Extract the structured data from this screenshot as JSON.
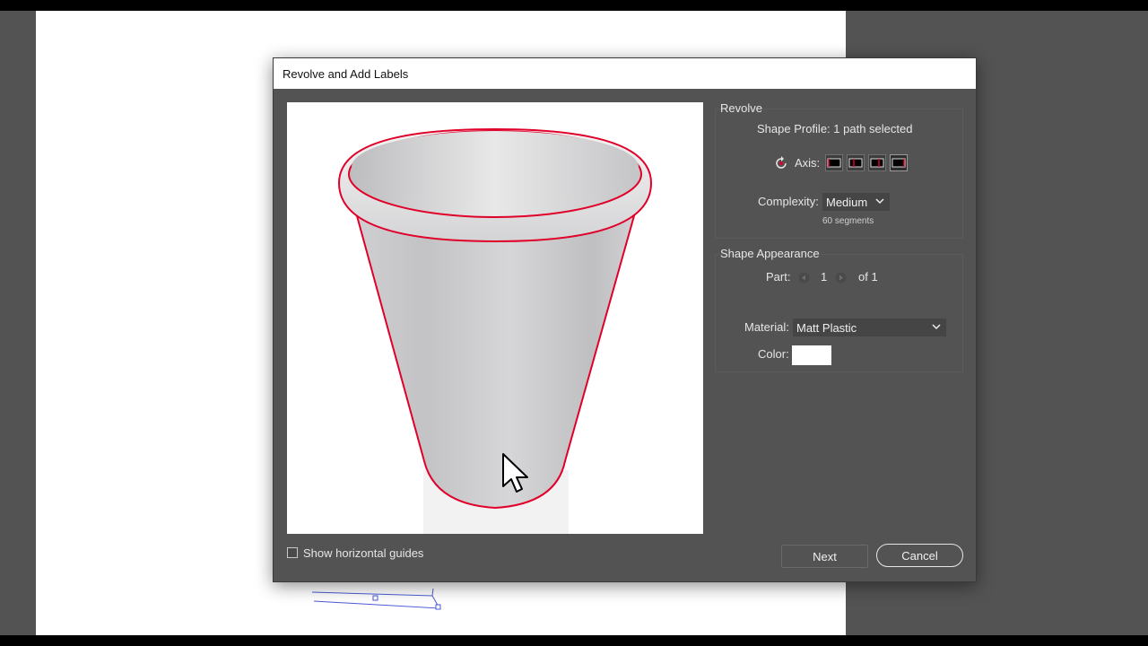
{
  "dialog": {
    "title": "Revolve and Add Labels",
    "revolve": {
      "header": "Revolve",
      "shape_profile": "Shape Profile: 1 path selected",
      "axis_label": "Axis:",
      "complexity_label": "Complexity:",
      "complexity_value": "Medium",
      "segments": "60 segments"
    },
    "appearance": {
      "header": "Shape Appearance",
      "part_label": "Part:",
      "part_value": "1",
      "part_of": "of 1",
      "material_label": "Material:",
      "material_value": "Matt Plastic",
      "color_label": "Color:",
      "color_value": "#ffffff"
    },
    "show_guides_label": "Show horizontal guides",
    "show_guides_checked": false,
    "next_label": "Next",
    "cancel_label": "Cancel"
  },
  "colors": {
    "accent_outline": "#e0002a",
    "dialog_bg": "#535353",
    "workspace_bg": "#535353"
  },
  "icons": [
    "rotate-axis-icon",
    "axis-left-icon",
    "axis-center-left-icon",
    "axis-center-right-icon",
    "axis-right-icon",
    "chevron-down-icon",
    "prev-part-icon",
    "next-part-icon",
    "mouse-cursor-icon"
  ]
}
